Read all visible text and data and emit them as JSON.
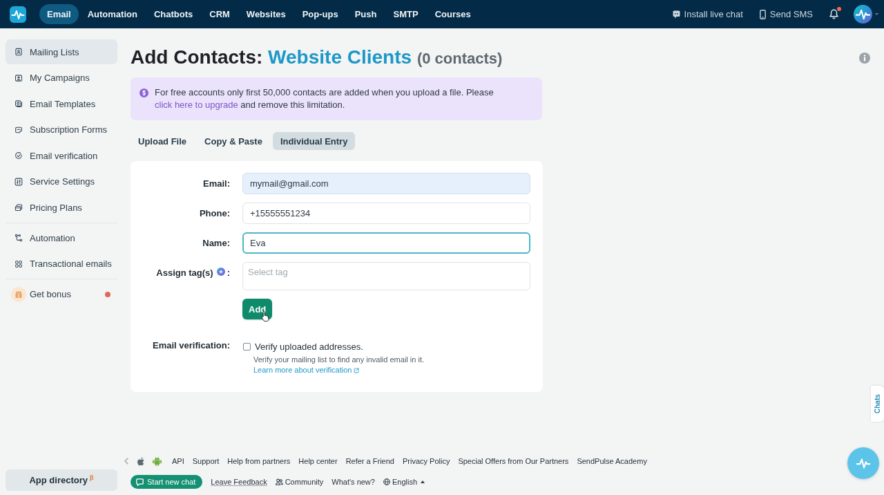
{
  "top_bar": {
    "nav": [
      {
        "label": "Email",
        "selected": true
      },
      {
        "label": "Automation",
        "selected": false
      },
      {
        "label": "Chatbots",
        "selected": false
      },
      {
        "label": "CRM",
        "selected": false
      },
      {
        "label": "Websites",
        "selected": false
      },
      {
        "label": "Pop-ups",
        "selected": false
      },
      {
        "label": "Push",
        "selected": false
      },
      {
        "label": "SMTP",
        "selected": false
      },
      {
        "label": "Courses",
        "selected": false
      }
    ],
    "actions": [
      "Install live chat",
      "Send SMS"
    ],
    "notifications_unread": true
  },
  "sidebar": {
    "groups": [
      {
        "items": [
          {
            "label": "Mailing Lists",
            "selected": true,
            "dot": false
          },
          {
            "label": "My Campaigns",
            "selected": false,
            "dot": false
          },
          {
            "label": "Email Templates",
            "selected": false,
            "dot": false
          },
          {
            "label": "Subscription Forms",
            "selected": false,
            "dot": false
          },
          {
            "label": "Email verification",
            "selected": false,
            "dot": false
          },
          {
            "label": "Service Settings",
            "selected": false,
            "dot": false
          },
          {
            "label": "Pricing Plans",
            "selected": false,
            "dot": false
          }
        ]
      },
      {
        "items": [
          {
            "label": "Automation",
            "selected": false,
            "dot": false
          },
          {
            "label": "Transactional emails",
            "selected": false,
            "dot": false
          }
        ]
      },
      {
        "items": [
          {
            "label": "Get bonus",
            "selected": false,
            "dot": true
          }
        ]
      }
    ],
    "app_directory": {
      "label": "App directory",
      "mark": "β"
    }
  },
  "page": {
    "title": {
      "prefix": "Add Contacts:",
      "list_name": "Website Clients",
      "count": "(0 contacts)"
    },
    "notice": {
      "text_before": "For free accounts only first 50,000 contacts are added when you upload a file. Please",
      "link": "click here to upgrade",
      "text_after": "and remove this limitation."
    },
    "tabs": [
      {
        "label": "Upload File",
        "selected": false
      },
      {
        "label": "Copy & Paste",
        "selected": false
      },
      {
        "label": "Individual Entry",
        "selected": true
      }
    ],
    "form": {
      "fields": [
        {
          "kind": "email",
          "label": "Email:",
          "value": "mymail@gmail.com",
          "autofilled": true,
          "focused": false
        },
        {
          "kind": "phone",
          "label": "Phone:",
          "value": "+15555551234",
          "autofilled": false,
          "focused": false
        },
        {
          "kind": "name",
          "label": "Name:",
          "value": "Eva",
          "autofilled": false,
          "focused": true
        },
        {
          "kind": "tags",
          "label": "Assign tag(s)",
          "label_suffix": ":",
          "placeholder": "Select tag",
          "autofilled": false,
          "focused": false
        }
      ],
      "submit": "Add",
      "verification": {
        "label": "Email verification:",
        "checkbox_label": "Verify uploaded addresses.",
        "checked": false,
        "hint": "Verify your mailing list to find any invalid email in it.",
        "link": "Learn more about verification"
      }
    }
  },
  "footer": {
    "links": [
      "API",
      "Support",
      "Help from partners",
      "Help center",
      "Refer a Friend",
      "Privacy Policy",
      "Special Offers from Our Partners",
      "SendPulse Academy"
    ],
    "chat_button": "Start new chat",
    "feedback_link": "Leave Feedback",
    "community_link": "Community",
    "whats_new_link": "What's new?",
    "language": "English"
  },
  "chats_tab": "Chats"
}
